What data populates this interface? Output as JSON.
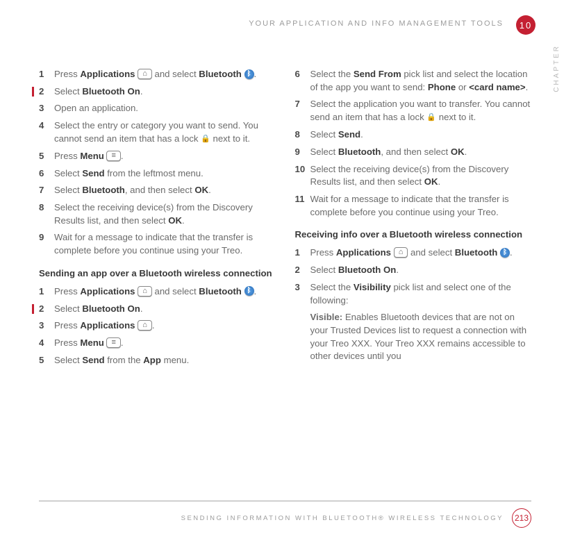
{
  "header": {
    "running": "YOUR APPLICATION AND INFO MANAGEMENT TOOLS",
    "chapter_number": "10",
    "chapter_label": "CHAPTER"
  },
  "left": {
    "steps_a": [
      {
        "n": "1",
        "pre": "Press ",
        "b1": "Applications",
        "icon1": "home",
        "mid": " and select ",
        "b2": "Bluetooth",
        "icon2": "bt",
        "post": "."
      },
      {
        "n": "2",
        "marker": true,
        "pre": "Select ",
        "b1": "Bluetooth On",
        "post": "."
      },
      {
        "n": "3",
        "pre": "Open an application."
      },
      {
        "n": "4",
        "pre": "Select the entry or category you want to send. You cannot send an item that has a lock ",
        "icon1": "lock",
        "post": " next to it."
      },
      {
        "n": "5",
        "pre": "Press ",
        "b1": "Menu",
        "icon1": "menu",
        "post": "."
      },
      {
        "n": "6",
        "pre": "Select ",
        "b1": "Send",
        "post": " from the leftmost menu."
      },
      {
        "n": "7",
        "pre": "Select ",
        "b1": "Bluetooth",
        "mid": ", and then select ",
        "b2": "OK",
        "post": "."
      },
      {
        "n": "8",
        "pre": "Select the receiving device(s) from the Discovery Results list, and then select ",
        "b1": "OK",
        "post": "."
      },
      {
        "n": "9",
        "pre": "Wait for a message to indicate that the transfer is complete before you continue using your Treo."
      }
    ],
    "subhead1": "Sending an app over a Bluetooth wireless connection",
    "steps_b": [
      {
        "n": "1",
        "pre": "Press ",
        "b1": "Applications",
        "icon1": "home",
        "mid": " and select ",
        "b2": "Bluetooth",
        "icon2": "bt",
        "post": "."
      },
      {
        "n": "2",
        "marker": true,
        "pre": "Select ",
        "b1": "Bluetooth On",
        "post": "."
      },
      {
        "n": "3",
        "pre": "Press ",
        "b1": "Applications",
        "icon1": "home",
        "post": "."
      },
      {
        "n": "4",
        "pre": "Press ",
        "b1": "Menu",
        "icon1": "menu",
        "post": "."
      },
      {
        "n": "5",
        "pre": "Select ",
        "b1": "Send",
        "mid": " from the ",
        "b2": "App",
        "post": " menu."
      }
    ]
  },
  "right": {
    "steps_c": [
      {
        "n": "6",
        "pre": "Select the ",
        "b1": "Send From",
        "mid": " pick list and select the location of the app you want to send: ",
        "b2": "Phone",
        "mid2": " or ",
        "b3": "<card name>",
        "post": "."
      },
      {
        "n": "7",
        "pre": "Select the application you want to transfer. You cannot send an item that has a lock ",
        "icon1": "lock",
        "post": " next to it."
      },
      {
        "n": "8",
        "pre": "Select ",
        "b1": "Send",
        "post": "."
      },
      {
        "n": "9",
        "pre": "Select ",
        "b1": "Bluetooth",
        "mid": ", and then select ",
        "b2": "OK",
        "post": "."
      },
      {
        "n": "10",
        "pre": "Select the receiving device(s) from the Discovery Results list, and then select ",
        "b1": "OK",
        "post": "."
      },
      {
        "n": "11",
        "pre": "Wait for a message to indicate that the transfer is complete before you continue using your Treo."
      }
    ],
    "subhead2": "Receiving info over a Bluetooth wireless connection",
    "steps_d": [
      {
        "n": "1",
        "pre": "Press ",
        "b1": "Applications",
        "icon1": "home",
        "mid": " and select ",
        "b2": "Bluetooth",
        "icon2": "bt",
        "post": "."
      },
      {
        "n": "2",
        "pre": "Select ",
        "b1": "Bluetooth On",
        "post": "."
      },
      {
        "n": "3",
        "pre": "Select the ",
        "b1": "Visibility",
        "post": " pick list and select one of the following:"
      }
    ],
    "visible_label": "Visible:",
    "visible_text": " Enables Bluetooth devices that are not on your Trusted Devices list to request a connection with your Treo XXX. Your Treo XXX remains accessible to other devices until you"
  },
  "footer": {
    "text": "SENDING INFORMATION WITH BLUETOOTH® WIRELESS TECHNOLOGY",
    "page": "213"
  }
}
